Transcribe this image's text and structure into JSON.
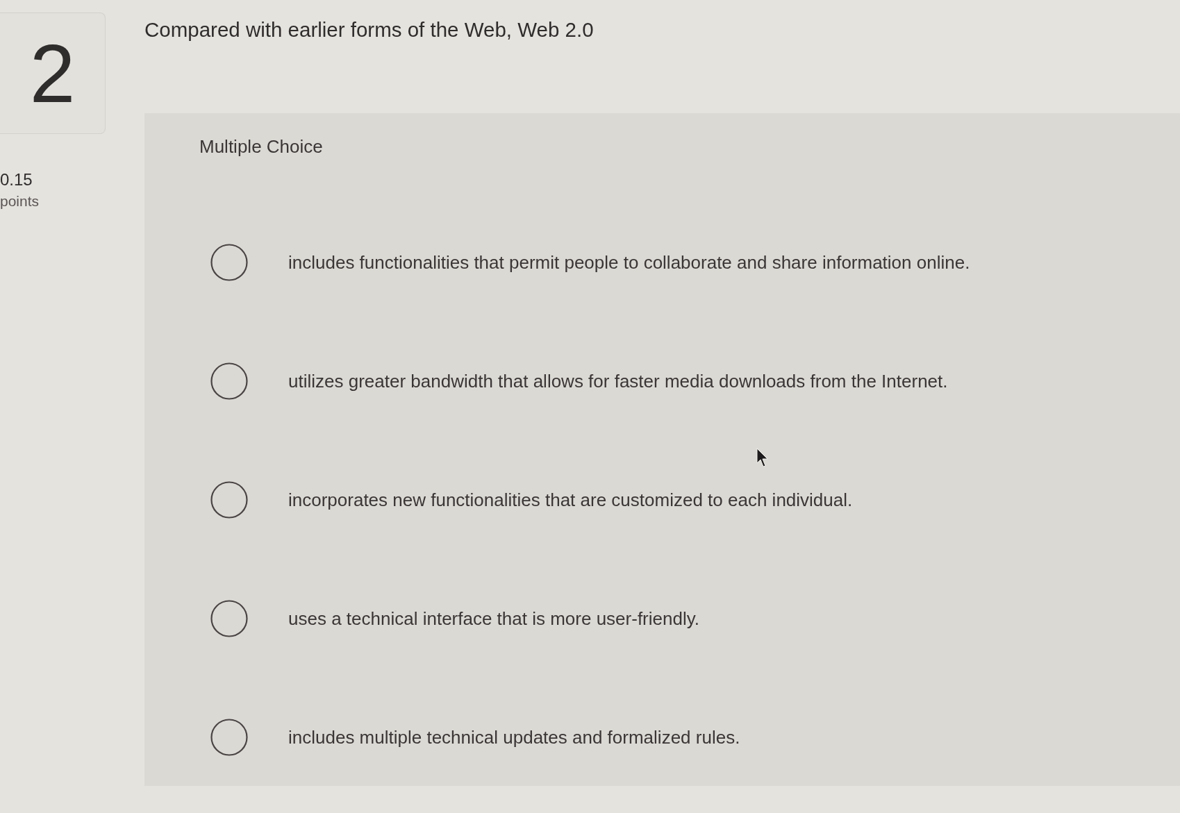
{
  "question": {
    "number": "2",
    "points_value": "0.15",
    "points_label": "points",
    "prompt": "Compared with earlier forms of the Web, Web 2.0"
  },
  "answer_panel": {
    "type_label": "Multiple Choice",
    "options": [
      {
        "text": "includes functionalities that permit people to collaborate and share information online.",
        "selected": false
      },
      {
        "text": "utilizes greater bandwidth that allows for faster media downloads from the Internet.",
        "selected": false
      },
      {
        "text": "incorporates new functionalities that are customized to each individual.",
        "selected": false
      },
      {
        "text": "uses a technical interface that is more user-friendly.",
        "selected": false
      },
      {
        "text": "includes multiple technical updates and formalized rules.",
        "selected": false
      }
    ]
  }
}
